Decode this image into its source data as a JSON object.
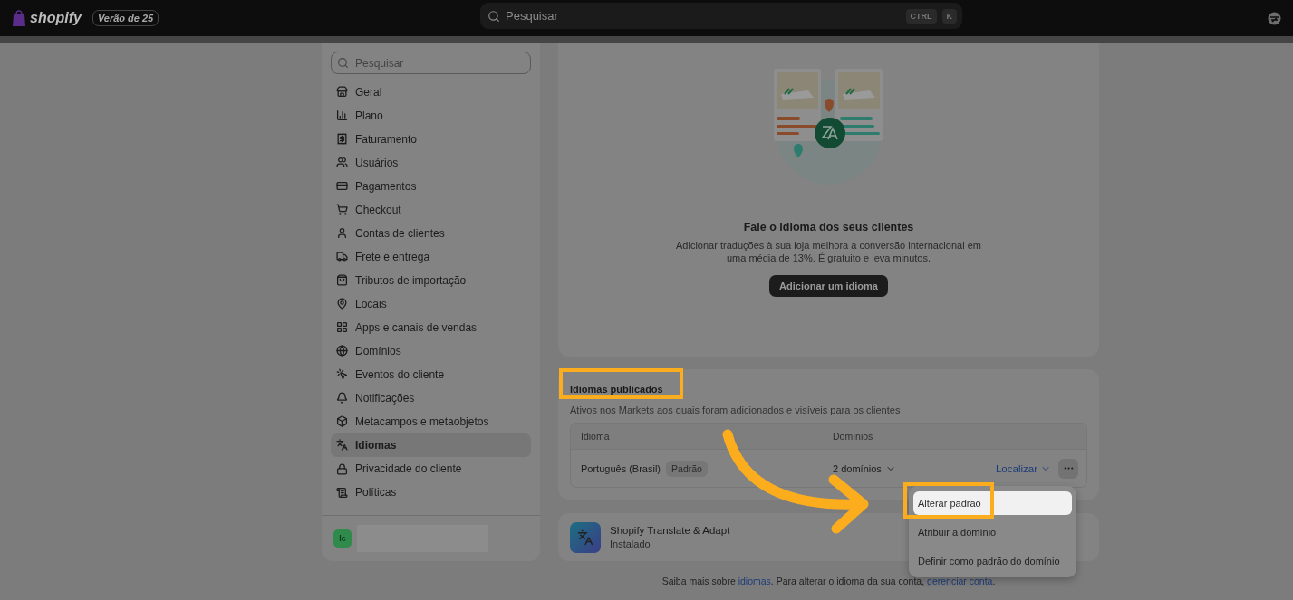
{
  "topbar": {
    "logo": "shopify",
    "badge": "Verão de 25",
    "search": {
      "placeholder": "Pesquisar"
    },
    "shortcut": [
      "CTRL",
      "K"
    ]
  },
  "sidebar": {
    "search": {
      "placeholder": "Pesquisar"
    },
    "items": [
      {
        "label": "Geral",
        "selected": false
      },
      {
        "label": "Plano",
        "selected": false
      },
      {
        "label": "Faturamento",
        "selected": false
      },
      {
        "label": "Usuários",
        "selected": false
      },
      {
        "label": "Pagamentos",
        "selected": false
      },
      {
        "label": "Checkout",
        "selected": false
      },
      {
        "label": "Contas de clientes",
        "selected": false
      },
      {
        "label": "Frete e entrega",
        "selected": false
      },
      {
        "label": "Tributos de importação",
        "selected": false
      },
      {
        "label": "Locais",
        "selected": false
      },
      {
        "label": "Apps e canais de vendas",
        "selected": false
      },
      {
        "label": "Domínios",
        "selected": false
      },
      {
        "label": "Eventos do cliente",
        "selected": false
      },
      {
        "label": "Notificações",
        "selected": false
      },
      {
        "label": "Metacampos e metaobjetos",
        "selected": false
      },
      {
        "label": "Idiomas",
        "selected": true
      },
      {
        "label": "Privacidade do cliente",
        "selected": false
      },
      {
        "label": "Políticas",
        "selected": false
      }
    ],
    "account": {
      "initials": "lc"
    }
  },
  "hero": {
    "title": "Fale o idioma dos seus clientes",
    "text": "Adicionar traduções à sua loja melhora a conversão internacional em uma média de 13%. É gratuito e leva minutos.",
    "button": "Adicionar um idioma"
  },
  "published": {
    "title": "Idiomas publicados",
    "subtitle": "Ativos nos Markets aos quais foram adicionados e visíveis para os clientes",
    "columns": [
      "Idioma",
      "Domínios"
    ],
    "rows": [
      {
        "language": "Português (Brasil)",
        "badge": "Padrão",
        "domains": "2 domínios",
        "action": "Localizar"
      }
    ]
  },
  "menu": [
    {
      "label": "Alterar padrão",
      "selected": true
    },
    {
      "label": "Atribuir a domínio",
      "selected": false
    },
    {
      "label": "Definir como padrão do domínio",
      "selected": false
    }
  ],
  "app": {
    "name": "Shopify Translate & Adapt",
    "status": "Instalado"
  },
  "footer": {
    "parts": [
      {
        "kind": "text",
        "text": "Saiba mais sobre "
      },
      {
        "kind": "link",
        "text": "idiomas"
      },
      {
        "kind": "text",
        "text": ". Para alterar o idioma da sua conta, "
      },
      {
        "kind": "link",
        "text": "gerenciar conta"
      },
      {
        "kind": "text",
        "text": "."
      }
    ]
  }
}
